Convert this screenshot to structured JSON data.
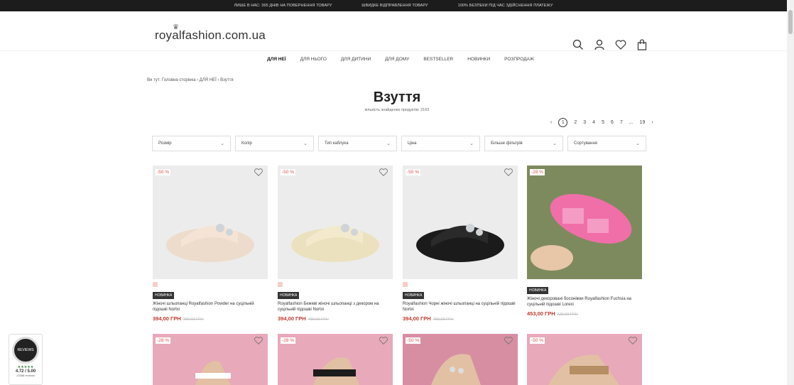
{
  "topbar": [
    "ЛИШЕ В НАС: 365 ДНІВ НА ПОВЕРНЕННЯ ТОВАРУ",
    "ШВИДКЕ ВІДПРАВЛЕННЯ ТОВАРУ",
    "100% БЕЗПЕКИ ПІД ЧАС ЗДІЙСНЕННЯ ПЛАТЕЖУ"
  ],
  "header": {
    "logo": "royalfashion.com.ua",
    "icons": [
      "search-icon",
      "user-icon",
      "heart-icon",
      "bag-icon"
    ]
  },
  "nav": [
    "ДЛЯ НЕЇ",
    "ДЛЯ НЬОГО",
    "ДЛЯ ДИТИНИ",
    "ДЛЯ ДОМУ",
    "BESTSELLER",
    "НОВИНКИ",
    "РОЗПРОДАЖ"
  ],
  "breadcrumb": "Ви тут:  Головна сторінка › ДЛЯ НЕЇ › Взуття",
  "page": {
    "title": "Взуття",
    "count": "кількість знайдених продуктів: 2163"
  },
  "pager": {
    "prev": "‹",
    "current": "1",
    "pages": [
      "2",
      "3",
      "4",
      "5",
      "6",
      "7",
      "...",
      "19"
    ],
    "next": "›"
  },
  "filters": [
    "Розмір",
    "Колір",
    "Тип каблука",
    "Ціна",
    "Більше фільтрів",
    "Сортування"
  ],
  "products": [
    {
      "badge": "-50 %",
      "tag": "НОВИНКА",
      "name": "Жіночі шльопанці Royalfashion Powder на суцільній підошві Nortxi",
      "price": "394,00 ГРН",
      "old": "789,00 ГРН",
      "color": "#f1dccd"
    },
    {
      "badge": "-50 %",
      "tag": "НОВИНКА",
      "name": "Royalfashion Бежеві жіночі шльопанці з декором на суцільній підошві Nortxi",
      "price": "394,00 ГРН",
      "old": "789,00 ГРН",
      "color": "#f0e6c8"
    },
    {
      "badge": "-50 %",
      "tag": "НОВИНКА",
      "name": "Royalfashion Чорні жіночі шльопанці на суцільній підошві Nortxi",
      "price": "394,00 ГРН",
      "old": "789,00 ГРН",
      "color": "#1b1b1b"
    },
    {
      "badge": "-28 %",
      "tag": "НОВИНКА",
      "name": "Жіночі декоровані босоніжки Royalfashion Fuchsia на суцільній підошві Lorexi",
      "price": "453,00 ГРН",
      "old": "629,00 ГРН",
      "color": "#f06fa8"
    }
  ],
  "row2_badges": [
    "-28 %",
    "-28 %",
    "-50 %",
    "-50 %"
  ],
  "reviews_widget": {
    "label": "REVIEWS",
    "score": "4.72 / 5.00",
    "count": "13388 reviews"
  }
}
